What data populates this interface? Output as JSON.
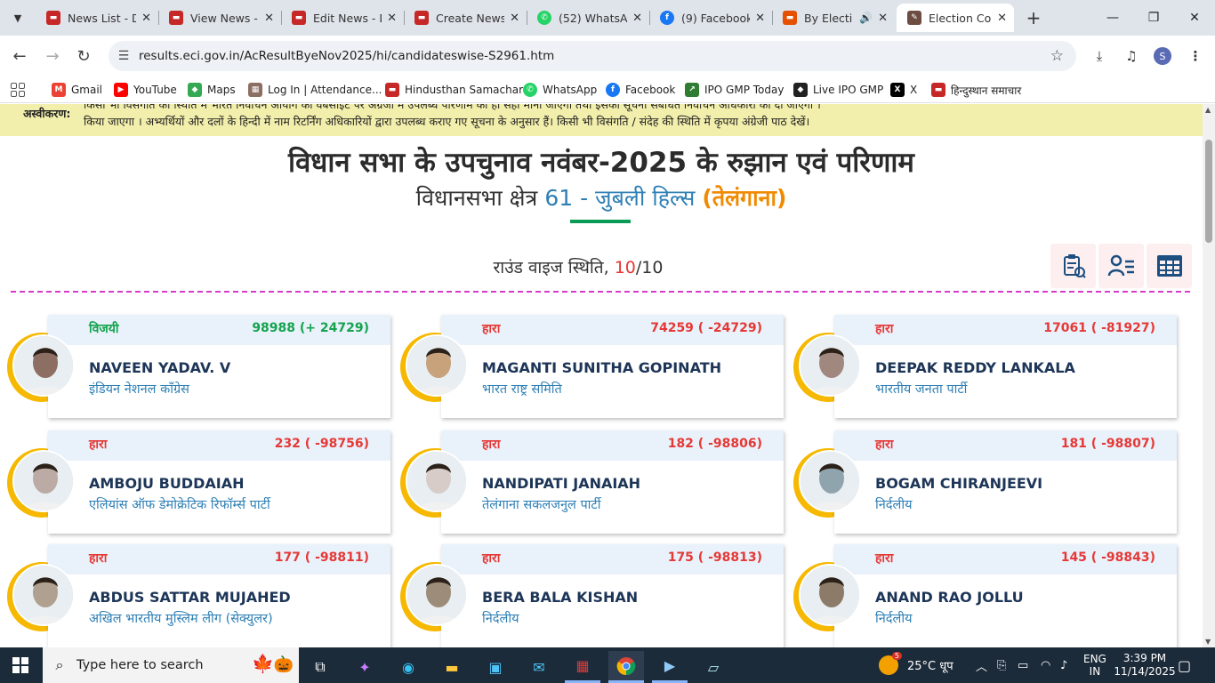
{
  "browser": {
    "tabs": [
      {
        "title": "News List - D",
        "color": "#c62828"
      },
      {
        "title": "View News - D",
        "color": "#c62828"
      },
      {
        "title": "Edit News - D",
        "color": "#c62828"
      },
      {
        "title": "Create News",
        "color": "#c62828"
      },
      {
        "title": "(52) WhatsA",
        "color": "#25d366"
      },
      {
        "title": "(9) Facebook",
        "color": "#1877f2"
      },
      {
        "title": "By Electi",
        "color": "#e65100"
      },
      {
        "title": "Election Con",
        "color": "#6d4c41"
      }
    ],
    "url": "results.eci.gov.in/AcResultByeNov2025/hi/candidateswise-S2961.htm",
    "avatar_letter": "S",
    "bookmarks": [
      {
        "label": "Gmail",
        "color": "#ea4335"
      },
      {
        "label": "YouTube",
        "color": "#ff0000"
      },
      {
        "label": "Maps",
        "color": "#34a853"
      },
      {
        "label": "Log In | Attendance...",
        "color": "#8d6e63"
      },
      {
        "label": "Hindusthan Samachar",
        "color": "#c62828"
      },
      {
        "label": "WhatsApp",
        "color": "#25d366"
      },
      {
        "label": "Facebook",
        "color": "#1877f2"
      },
      {
        "label": "IPO GMP Today",
        "color": "#2e7d32"
      },
      {
        "label": "Live IPO GMP",
        "color": "#212121"
      },
      {
        "label": "X",
        "color": "#000000"
      },
      {
        "label": "हिन्दुस्थान समाचार",
        "color": "#c62828"
      }
    ]
  },
  "page": {
    "disclaimer_label": "अस्वीकरण:",
    "disclaimer_line1": "किसी भी विसंगति की स्थिति में भारत निर्वाचन आयोग की वेबसाइट पर अंग्रेजी में उपलब्ध परिणाम को ही सही माना जाएगा तथा इसकी सूचना संबंधित निर्वाचन अधिकारी को दी जाएगी ।",
    "disclaimer_line2": "किया जाएगा । अभ्यर्थियों और दलों के हिन्दी में नाम रिटर्निंग अधिकारियों द्वारा उपलब्ध कराए गए सूचना के अनुसार हैं। किसी भी विसंगति / संदेह की स्थिति में कृपया अंग्रेजी पाठ देखें।",
    "title": "विधान सभा के उपचुनाव नवंबर-2025 के रुझान एवं परिणाम",
    "subtitle_prefix": "विधानसभा क्षेत्र",
    "constituency": "61 - जुबली हिल्स",
    "state": "(तेलंगाना)",
    "round_label": "राउंड वाइज स्थिति,",
    "round_current": "10",
    "round_total": "/10"
  },
  "candidates": [
    {
      "status": "विजयी",
      "won": true,
      "votes": "98988 (+ 24729)",
      "name": "NAVEEN YADAV. V",
      "party": "इंडियन नेशनल कॉंग्रेस"
    },
    {
      "status": "हारा",
      "won": false,
      "votes": "74259 ( -24729)",
      "name": "MAGANTI SUNITHA GOPINATH",
      "party": "भारत राष्ट्र समिति"
    },
    {
      "status": "हारा",
      "won": false,
      "votes": "17061 ( -81927)",
      "name": "DEEPAK REDDY LANKALA",
      "party": "भारतीय जनता पार्टी"
    },
    {
      "status": "हारा",
      "won": false,
      "votes": "232 ( -98756)",
      "name": "AMBOJU BUDDAIAH",
      "party": "एलियांस ऑफ डेमोक्रेटिक रिफॉर्म्स पार्टी"
    },
    {
      "status": "हारा",
      "won": false,
      "votes": "182 ( -98806)",
      "name": "NANDIPATI JANAIAH",
      "party": "तेलंगाना सकलजनुल पार्टी"
    },
    {
      "status": "हारा",
      "won": false,
      "votes": "181 ( -98807)",
      "name": "BOGAM CHIRANJEEVI",
      "party": "निर्दलीय"
    },
    {
      "status": "हारा",
      "won": false,
      "votes": "177 ( -98811)",
      "name": "ABDUS SATTAR MUJAHED",
      "party": "अखिल भारतीय मुस्लिम लीग (सेक्युलर)"
    },
    {
      "status": "हारा",
      "won": false,
      "votes": "175 ( -98813)",
      "name": "BERA BALA KISHAN",
      "party": "निर्दलीय"
    },
    {
      "status": "हारा",
      "won": false,
      "votes": "145 ( -98843)",
      "name": "ANAND RAO JOLLU",
      "party": "निर्दलीय"
    }
  ],
  "taskbar": {
    "search_placeholder": "Type here to search",
    "weather": "25°C धूप",
    "lang_top": "ENG",
    "lang_bottom": "IN",
    "time": "3:39 PM",
    "date": "11/14/2025",
    "weather_badge": "5"
  }
}
